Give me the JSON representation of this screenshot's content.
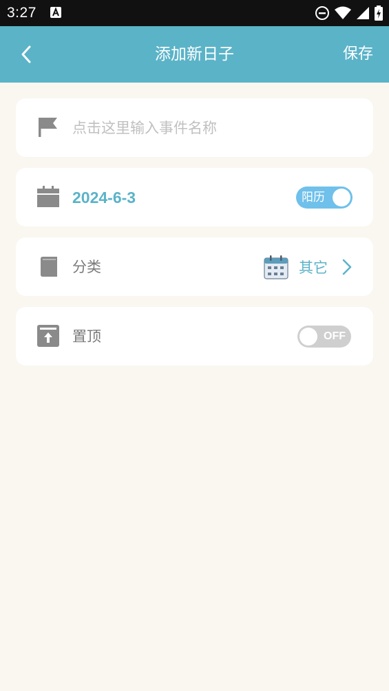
{
  "status_bar": {
    "time": "3:27",
    "icons": [
      "a-notification-icon",
      "do-not-disturb-icon",
      "wifi-icon",
      "signal-icon",
      "battery-icon"
    ]
  },
  "header": {
    "title": "添加新日子",
    "save_label": "保存",
    "background_color": "#5bb3c8"
  },
  "event_name": {
    "placeholder": "点击这里输入事件名称",
    "icon": "flag-icon"
  },
  "date": {
    "value": "2024-6-3",
    "icon": "calendar-icon",
    "calendar_type_label": "阳历",
    "calendar_type_on": true
  },
  "category": {
    "label": "分类",
    "value": "其它",
    "icon": "book-icon",
    "value_icon": "calendar-grid-icon"
  },
  "pin_top": {
    "label": "置顶",
    "icon": "pin-top-icon",
    "toggle_label": "OFF",
    "enabled": false
  },
  "colors": {
    "accent": "#5bb3c8",
    "page_background": "#faf7f0",
    "toggle_on": "#6fc0ea",
    "toggle_off": "#cfcfcf"
  }
}
